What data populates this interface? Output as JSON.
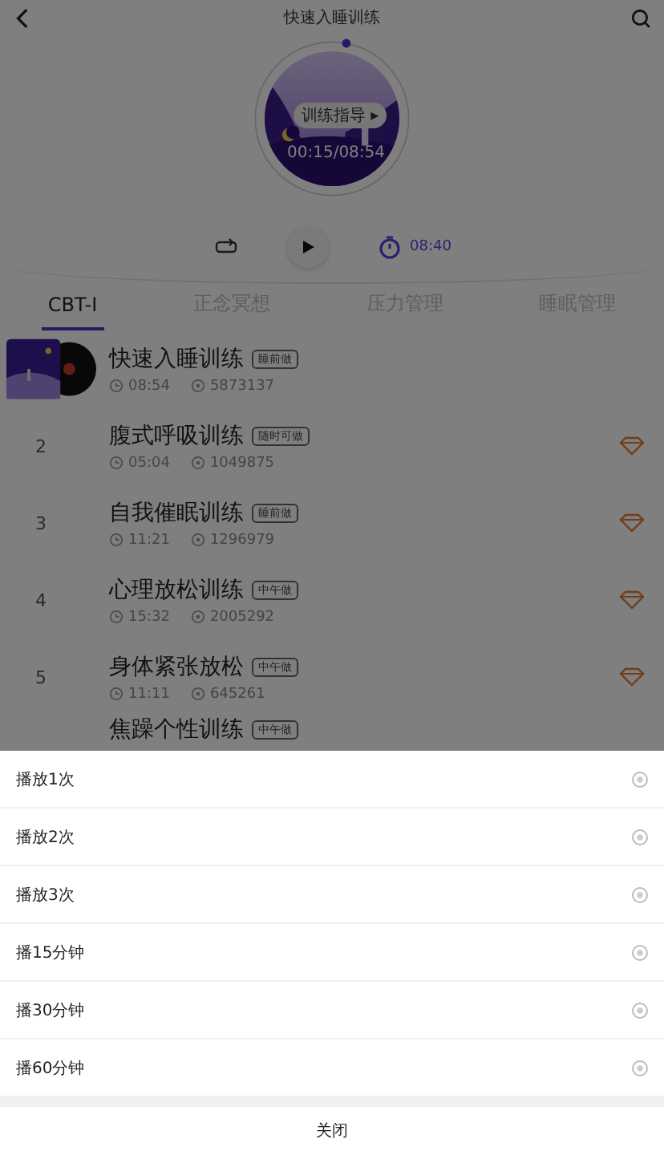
{
  "header": {
    "title": "快速入睡训练"
  },
  "player": {
    "guide_button": "训练指导 ▸",
    "time": "00:15/08:54",
    "timer": "08:40"
  },
  "tabs": [
    {
      "label": "CBT-I",
      "selected": true
    },
    {
      "label": "正念冥想",
      "selected": false
    },
    {
      "label": "压力管理",
      "selected": false
    },
    {
      "label": "睡眠管理",
      "selected": false
    }
  ],
  "tracks": [
    {
      "kind": "featured",
      "title": "快速入睡训练",
      "tag": "睡前做",
      "duration": "08:54",
      "plays": "5873137",
      "vip": false
    },
    {
      "kind": "numbered",
      "rank": "2",
      "title": "腹式呼吸训练",
      "tag": "随时可做",
      "duration": "05:04",
      "plays": "1049875",
      "vip": true
    },
    {
      "kind": "numbered",
      "rank": "3",
      "title": "自我催眠训练",
      "tag": "睡前做",
      "duration": "11:21",
      "plays": "1296979",
      "vip": true
    },
    {
      "kind": "numbered",
      "rank": "4",
      "title": "心理放松训练",
      "tag": "中午做",
      "duration": "15:32",
      "plays": "2005292",
      "vip": true
    },
    {
      "kind": "numbered",
      "rank": "5",
      "title": "身体紧张放松",
      "tag": "中午做",
      "duration": "11:11",
      "plays": "645261",
      "vip": true
    },
    {
      "kind": "numbered",
      "title": "焦躁个性训练",
      "tag": "中午做"
    }
  ],
  "sheet": {
    "options": [
      {
        "label": "播放1次",
        "selected": false
      },
      {
        "label": "播放2次",
        "selected": false
      },
      {
        "label": "播放3次",
        "selected": false
      },
      {
        "label": "播15分钟",
        "selected": false
      },
      {
        "label": "播30分钟",
        "selected": false
      },
      {
        "label": "播60分钟",
        "selected": false
      }
    ],
    "close": "关闭"
  }
}
